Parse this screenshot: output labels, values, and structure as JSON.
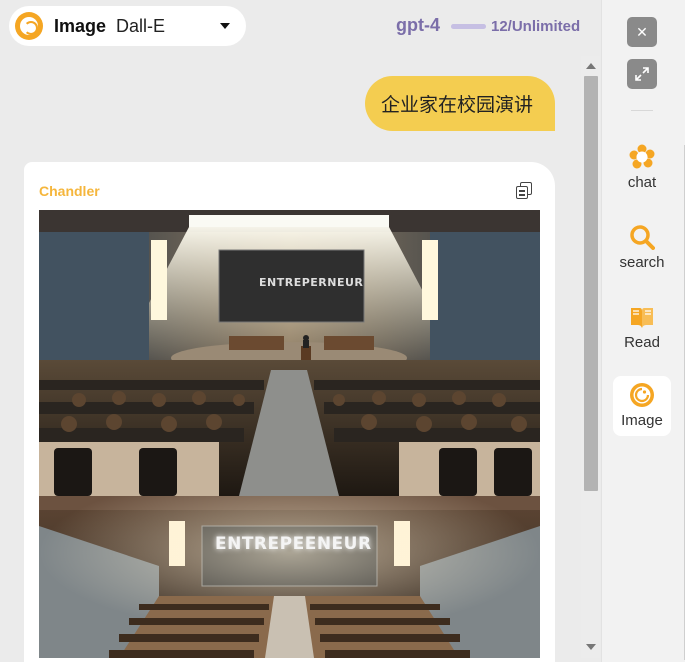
{
  "mode_selector": {
    "title": "Image",
    "value": "Dall-E",
    "logo_icon": "palette-logo-icon",
    "caret_icon": "caret-down-icon"
  },
  "model": {
    "name": "gpt-4",
    "usage": "12/Unlimited"
  },
  "conversation": {
    "user_message": "企业家在校园演讲",
    "bot_name": "Chandler",
    "copy_icon": "copy-icon",
    "images": [
      {
        "screen_text": "ENTREPERNEUR"
      },
      {
        "screen_text": "ENTREPEENEUR"
      }
    ]
  },
  "sidebar": {
    "close_icon": "close-icon",
    "expand_icon": "expand-icon",
    "items": [
      {
        "label": "chat",
        "icon": "chat-icon",
        "active": false
      },
      {
        "label": "search",
        "icon": "search-icon",
        "active": false
      },
      {
        "label": "Read",
        "icon": "book-icon",
        "active": false
      },
      {
        "label": "Image",
        "icon": "palette-icon",
        "active": true
      }
    ]
  },
  "colors": {
    "accent": "#f5a623",
    "model": "#7b6ea9",
    "user_bubble": "#f4cd50",
    "bot_name": "#f5b63c"
  }
}
